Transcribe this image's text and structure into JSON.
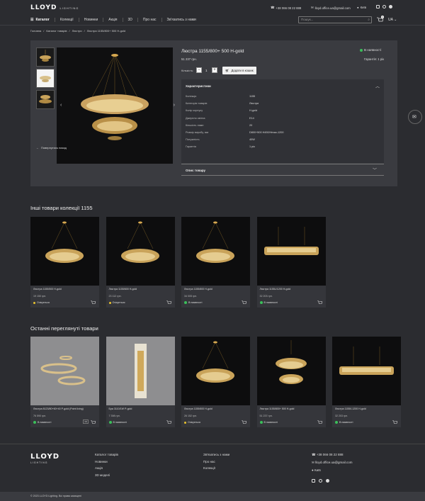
{
  "header": {
    "logo": "LLOYD",
    "logo_sub": "LIGHTING",
    "phone": "+38 066 08 22 888",
    "email": "lloyd.office.ua@gmail.com",
    "city": "Київ"
  },
  "nav": {
    "catalog": "Каталог",
    "items": [
      "Колекції",
      "Новинки",
      "Акція",
      "3D",
      "Про нас",
      "Зв'язатись з нами"
    ],
    "search_placeholder": "Пошук...",
    "cart_count": "0",
    "lang": "UA"
  },
  "breadcrumb": [
    "Головна",
    "Каталог товарів",
    "Люстри",
    "Люстра 1155/800+ 500 H-gold"
  ],
  "product": {
    "title": "Люстра 1155/800+ 500 H-gold",
    "price": "51 237 грн.",
    "availability": "В наявності",
    "warranty": "Гарантія: 1 рік",
    "qty_label": "Кількість:",
    "qty": "1",
    "add_to_cart": "Додати в кошик",
    "back": "Повернутись назад",
    "specs_title": "Характеристики",
    "specs": [
      {
        "k": "Колекція",
        "v": "1155"
      },
      {
        "k": "Категорія товарів",
        "v": "Люстри"
      },
      {
        "k": "Колір корпусу",
        "v": "H-gold"
      },
      {
        "k": "Джерело світла",
        "v": "E14"
      },
      {
        "k": "Кількість ламп",
        "v": "20"
      },
      {
        "k": "Розмір виробу, мм",
        "v": "D800+500 H450/Hmax-1200"
      },
      {
        "k": "Потужність",
        "v": "40W"
      },
      {
        "k": "Гарантія",
        "v": "1 рік"
      }
    ],
    "desc_title": "Опис товару"
  },
  "collection": {
    "title": "Інші товари колекції 1155",
    "items": [
      {
        "name": "Люстра 1155/500 H-gold",
        "price": "19 150 грн.",
        "stock": "Очікується",
        "status": "yellow"
      },
      {
        "name": "Люстра 1155/600 H-gold",
        "price": "23 112 грн.",
        "stock": "Очікується",
        "status": "yellow"
      },
      {
        "name": "Люстра 1155/800 H-gold",
        "price": "34 005 грн.",
        "stock": "В наявності",
        "status": "green"
      },
      {
        "name": "Люстра 1155L/1200 H-gold",
        "price": "32 203 грн.",
        "stock": "В наявності",
        "status": "green"
      }
    ]
  },
  "recent": {
    "title": "Останні переглянуті товари",
    "items": [
      {
        "name": "Люстра 8123/80+60+40 P-gold (Point living)",
        "price": "76 590 грн.",
        "stock": "В наявності",
        "status": "green",
        "badge": "3D"
      },
      {
        "name": "Бра 3110/1W P-gold",
        "price": "7 398 грн.",
        "stock": "В наявності",
        "status": "green",
        "badge": ""
      },
      {
        "name": "Люстра 1155/600 H-gold",
        "price": "26 152 грн.",
        "stock": "Очікується",
        "status": "yellow",
        "badge": ""
      },
      {
        "name": "Люстра 1155/800+ 500 H-gold",
        "price": "51 237 грн.",
        "stock": "В наявності",
        "status": "green",
        "badge": ""
      },
      {
        "name": "Люстра 1155/L1200 H-gold",
        "price": "32 203 грн.",
        "stock": "В наявності",
        "status": "green",
        "badge": ""
      }
    ]
  },
  "footer": {
    "col1": [
      "Каталог товарів",
      "Новинки",
      "Акція",
      "3D моделі"
    ],
    "col2": [
      "Зв'язатись з нами",
      "Про нас",
      "Колекції"
    ],
    "phone": "+38 066 08 22 888",
    "email": "lloyd.office.ua@gmail.com",
    "city": "Київ",
    "copyright": "© 2023 LLOYD Lighting. Всі права захищені"
  },
  "colors": {
    "bg": "#2b2c30",
    "panel": "#3a3b40",
    "in_stock": "#3bbf5a",
    "expected": "#e8c22e"
  }
}
